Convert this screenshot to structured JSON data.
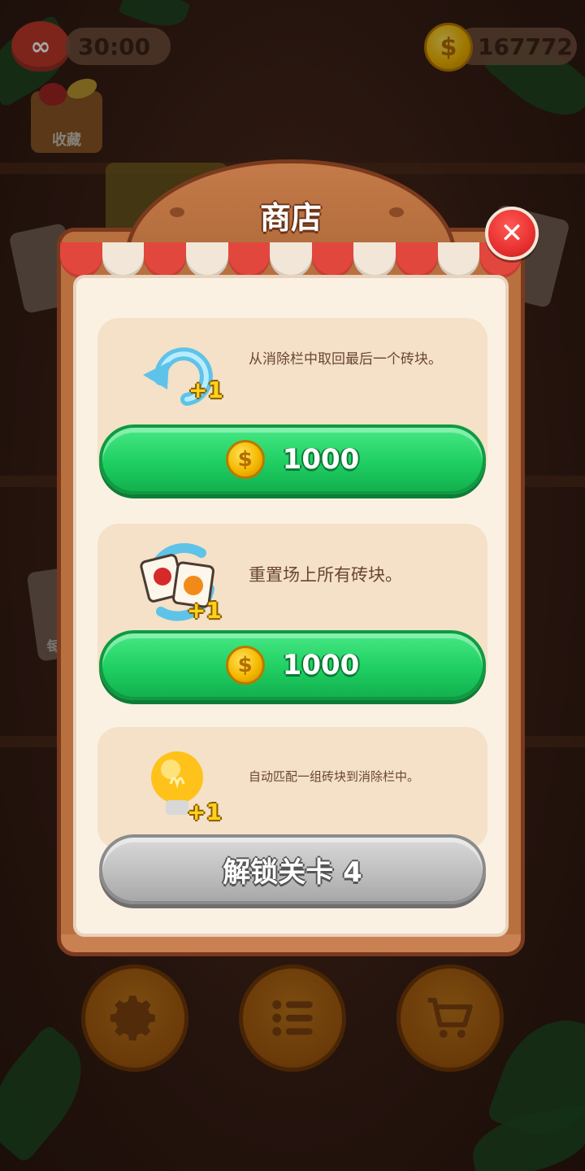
{
  "hud": {
    "lives_timer": "30:00",
    "coins": "167772",
    "collection_label": "收藏",
    "daily_label_partial": "每"
  },
  "shop": {
    "title": "商店",
    "items": [
      {
        "icon": "undo-icon",
        "plus": "+1",
        "description": "从消除栏中取回最后一个砖块。",
        "button": {
          "type": "price",
          "price": "1000",
          "icon": "coin-icon"
        }
      },
      {
        "icon": "shuffle-icon",
        "plus": "+1",
        "description": "重置场上所有砖块。",
        "button": {
          "type": "price",
          "price": "1000",
          "icon": "coin-icon"
        }
      },
      {
        "icon": "hint-bulb-icon",
        "plus": "+1",
        "description": "自动匹配一组砖块到消除栏中。",
        "button": {
          "type": "locked",
          "label": "解锁关卡 4"
        }
      }
    ]
  },
  "bottom_nav": [
    {
      "icon": "gear-icon"
    },
    {
      "icon": "list-icon"
    },
    {
      "icon": "cart-icon"
    }
  ],
  "colors": {
    "accent_green": "#1fcf62",
    "close_red": "#e52e2e",
    "coin_gold": "#f5b800",
    "panel_wood": "#b9703f"
  }
}
